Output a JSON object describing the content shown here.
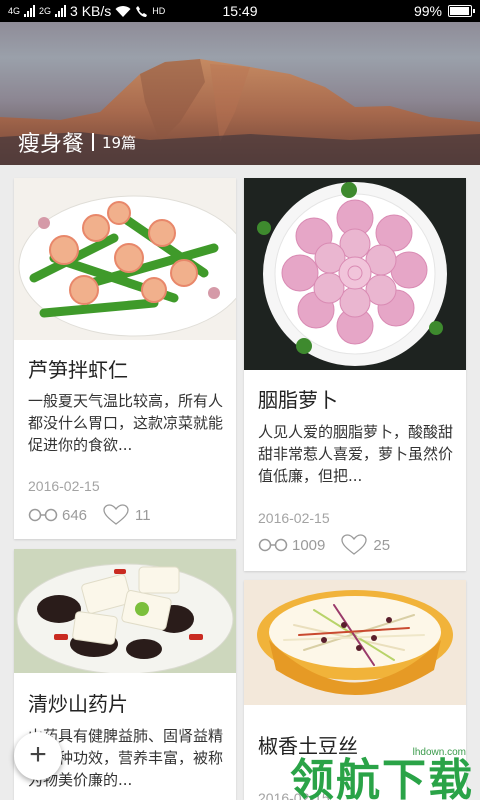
{
  "status_bar": {
    "network_speed": "3 KB/s",
    "time": "15:49",
    "battery_percent": "99%",
    "battery_level": 0.99,
    "hd_label": "HD",
    "sim1_label": "4G",
    "sim2_label": "2G"
  },
  "header": {
    "title": "瘦身餐",
    "count": "19篇"
  },
  "cards": [
    {
      "title": "芦笋拌虾仁",
      "description": "一般夏天气温比较高，所有人都没什么胃口，这款凉菜就能促进你的食欲...",
      "date": "2016-02-15",
      "views": "646",
      "likes": "11"
    },
    {
      "title": "胭脂萝卜",
      "description": "人见人爱的胭脂萝卜，酸酸甜甜非常惹人喜爱，萝卜虽然价值低廉，但把...",
      "date": "2016-02-15",
      "views": "1009",
      "likes": "25"
    },
    {
      "title": "清炒山药片",
      "description": "山药具有健脾益肺、固肾益精等多种功效，营养丰富，被称为物美价廉的...",
      "date": "",
      "views": "",
      "likes": ""
    },
    {
      "title": "椒香土豆丝",
      "description": "",
      "date": "2016-02-15",
      "views": "",
      "likes": ""
    }
  ],
  "fab": {
    "label": "+"
  },
  "watermark": {
    "text": "领航下载",
    "url": "lhdown.com"
  },
  "colors": {
    "background": "#ececec",
    "card": "#ffffff",
    "meta_gray": "#a3a3a3",
    "watermark_green": "#1f9f3e"
  },
  "icons": {
    "views": "glasses-icon",
    "likes": "heart-icon",
    "wifi": "wifi-icon",
    "signal": "signal-icon",
    "battery": "battery-icon"
  }
}
